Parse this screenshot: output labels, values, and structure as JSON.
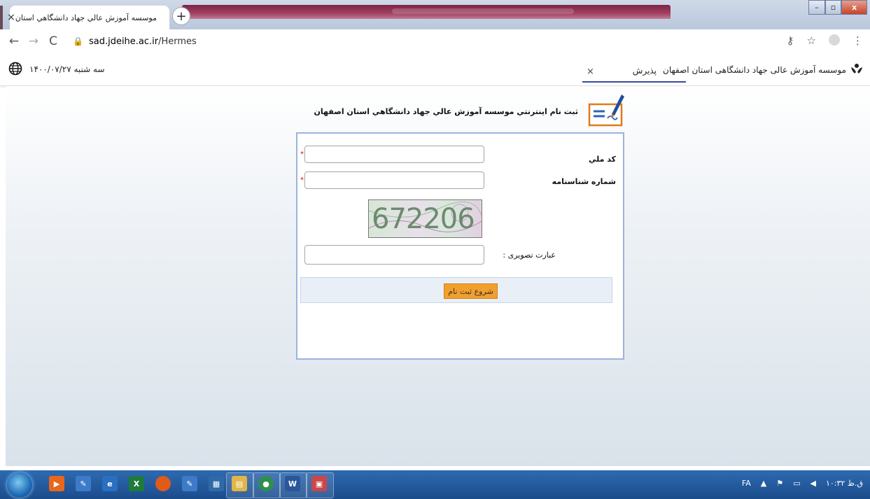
{
  "browser": {
    "tab_title": "موسسه آموزش عالي جهاد دانشگاهي استان",
    "tab_close": "×",
    "new_tab": "+",
    "url_domain": "sad.jdeihe.ac.ir",
    "url_path": "/Hermes",
    "window_buttons": {
      "minimize": "–",
      "maximize": "▫",
      "close": "x"
    }
  },
  "header": {
    "org_name": "موسسه آموزش عالی جهاد دانشگاهی استان اصفهان",
    "menu_tab_label": "پذیرش",
    "menu_tab_close": "×",
    "date_text": "سه شنبه  ۱۴۰۰/۰۷/۲۷"
  },
  "form": {
    "title": "ثبت نام اينترنتي موسسه آموزش عالي جهاد دانشگاهي استان اصفهان",
    "national_code_label": "کد ملي",
    "id_number_label": "شماره شناسنامه",
    "required_mark": "*",
    "captcha_code": "672206",
    "captcha_label": "عبارت تصويری :",
    "submit_label": "شروع ثبت نام"
  },
  "taskbar": {
    "language": "FA",
    "clock": "ق.ظ ۱۰:۳۲"
  },
  "colors": {
    "form_border": "#9bb4de",
    "submit_button": "#f2a02d",
    "tab_underline": "#3a4a9c",
    "taskbar": "#1b4c8c"
  },
  "icons": [
    "globe-icon",
    "org-logo-icon",
    "form-edit-icon",
    "lock-icon",
    "key-icon",
    "star-icon",
    "profile-icon",
    "menu-icon"
  ]
}
